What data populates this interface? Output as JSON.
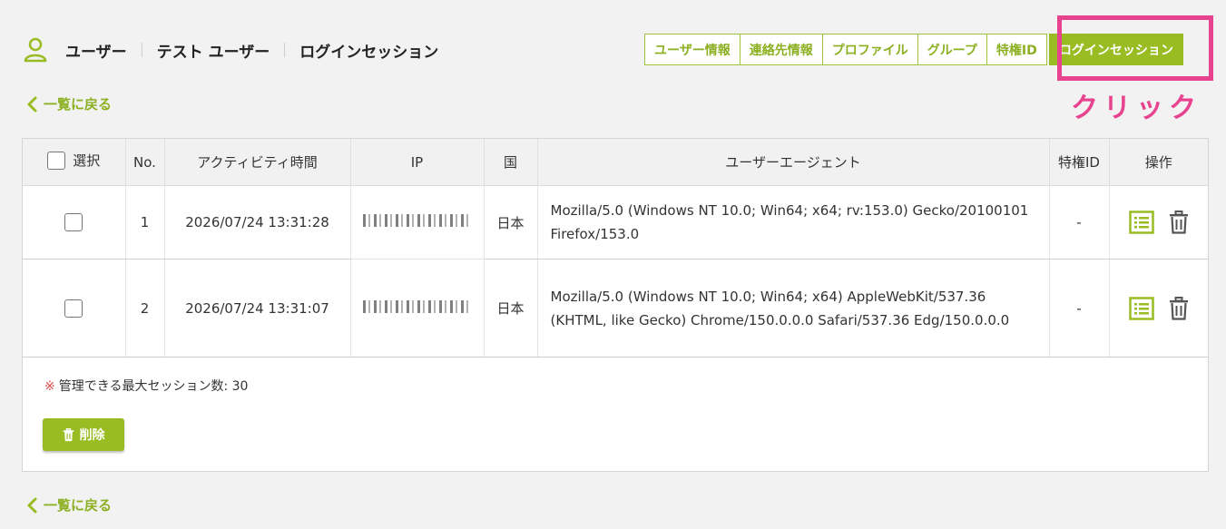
{
  "breadcrumb": {
    "section": "ユーザー",
    "user": "テスト ユーザー",
    "page": "ログインセッション"
  },
  "tabs": [
    "ユーザー情報",
    "連絡先情報",
    "プロファイル",
    "グループ",
    "特権ID",
    "ログインセッション"
  ],
  "active_tab": "ログインセッション",
  "annotation": {
    "label": "クリック",
    "color": "#e8438f"
  },
  "back_link": "一覧に戻る",
  "table": {
    "headers": {
      "select": "選択",
      "no": "No.",
      "time": "アクティビティ時間",
      "ip": "IP",
      "country": "国",
      "ua": "ユーザーエージェント",
      "priv": "特権ID",
      "ops": "操作"
    },
    "rows": [
      {
        "no": "1",
        "time": "2026/07/24 13:31:28",
        "country": "日本",
        "ua": "Mozilla/5.0 (Windows NT 10.0; Win64; x64; rv:153.0) Gecko/20100101 Firefox/153.0",
        "priv": "-"
      },
      {
        "no": "2",
        "time": "2026/07/24 13:31:07",
        "country": "日本",
        "ua": "Mozilla/5.0 (Windows NT 10.0; Win64; x64) AppleWebKit/537.36 (KHTML, like Gecko) Chrome/150.0.0.0 Safari/537.36 Edg/150.0.0.0",
        "priv": "-"
      }
    ]
  },
  "note": {
    "mark": "※",
    "text": "管理できる最大セッション数: 30"
  },
  "delete_button": "削除",
  "colors": {
    "accent": "#99bc23",
    "accent_text": "#8cb021",
    "highlight": "#e8438f"
  }
}
